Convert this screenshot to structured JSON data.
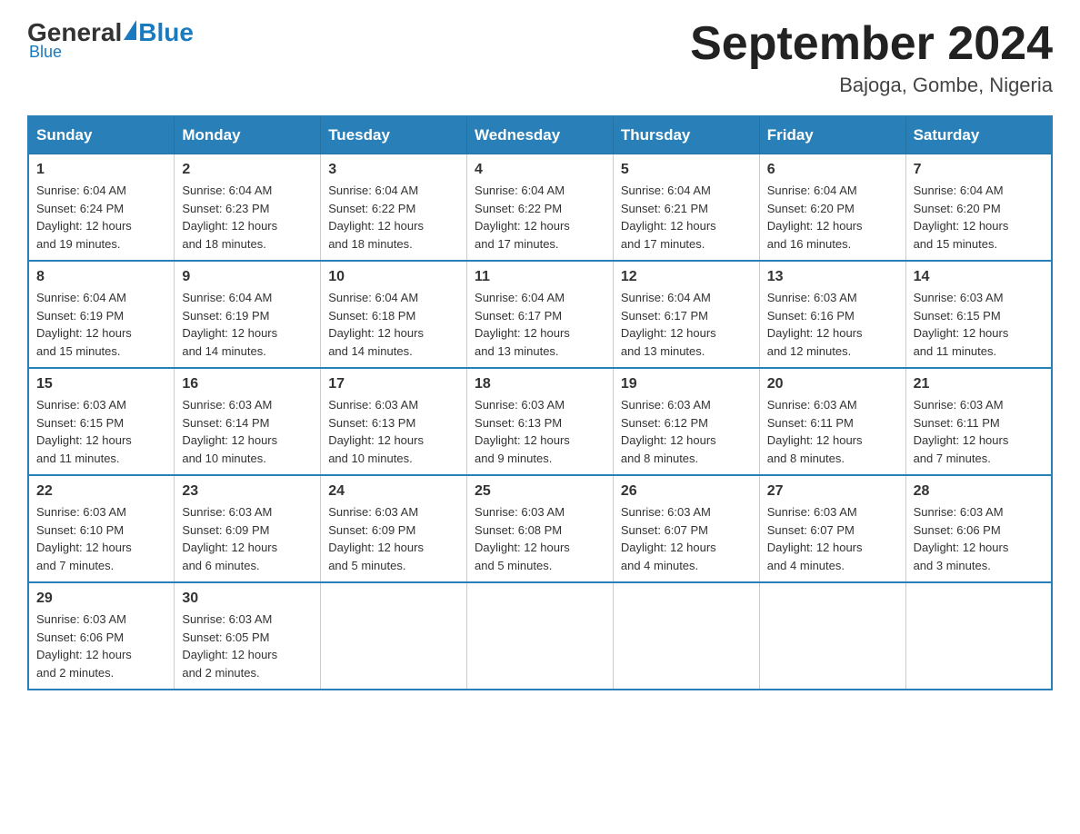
{
  "logo": {
    "general": "General",
    "blue": "Blue"
  },
  "title": {
    "month_year": "September 2024",
    "location": "Bajoga, Gombe, Nigeria"
  },
  "days_of_week": [
    "Sunday",
    "Monday",
    "Tuesday",
    "Wednesday",
    "Thursday",
    "Friday",
    "Saturday"
  ],
  "weeks": [
    [
      {
        "day": "1",
        "sunrise": "6:04 AM",
        "sunset": "6:24 PM",
        "daylight": "12 hours and 19 minutes."
      },
      {
        "day": "2",
        "sunrise": "6:04 AM",
        "sunset": "6:23 PM",
        "daylight": "12 hours and 18 minutes."
      },
      {
        "day": "3",
        "sunrise": "6:04 AM",
        "sunset": "6:22 PM",
        "daylight": "12 hours and 18 minutes."
      },
      {
        "day": "4",
        "sunrise": "6:04 AM",
        "sunset": "6:22 PM",
        "daylight": "12 hours and 17 minutes."
      },
      {
        "day": "5",
        "sunrise": "6:04 AM",
        "sunset": "6:21 PM",
        "daylight": "12 hours and 17 minutes."
      },
      {
        "day": "6",
        "sunrise": "6:04 AM",
        "sunset": "6:20 PM",
        "daylight": "12 hours and 16 minutes."
      },
      {
        "day": "7",
        "sunrise": "6:04 AM",
        "sunset": "6:20 PM",
        "daylight": "12 hours and 15 minutes."
      }
    ],
    [
      {
        "day": "8",
        "sunrise": "6:04 AM",
        "sunset": "6:19 PM",
        "daylight": "12 hours and 15 minutes."
      },
      {
        "day": "9",
        "sunrise": "6:04 AM",
        "sunset": "6:19 PM",
        "daylight": "12 hours and 14 minutes."
      },
      {
        "day": "10",
        "sunrise": "6:04 AM",
        "sunset": "6:18 PM",
        "daylight": "12 hours and 14 minutes."
      },
      {
        "day": "11",
        "sunrise": "6:04 AM",
        "sunset": "6:17 PM",
        "daylight": "12 hours and 13 minutes."
      },
      {
        "day": "12",
        "sunrise": "6:04 AM",
        "sunset": "6:17 PM",
        "daylight": "12 hours and 13 minutes."
      },
      {
        "day": "13",
        "sunrise": "6:03 AM",
        "sunset": "6:16 PM",
        "daylight": "12 hours and 12 minutes."
      },
      {
        "day": "14",
        "sunrise": "6:03 AM",
        "sunset": "6:15 PM",
        "daylight": "12 hours and 11 minutes."
      }
    ],
    [
      {
        "day": "15",
        "sunrise": "6:03 AM",
        "sunset": "6:15 PM",
        "daylight": "12 hours and 11 minutes."
      },
      {
        "day": "16",
        "sunrise": "6:03 AM",
        "sunset": "6:14 PM",
        "daylight": "12 hours and 10 minutes."
      },
      {
        "day": "17",
        "sunrise": "6:03 AM",
        "sunset": "6:13 PM",
        "daylight": "12 hours and 10 minutes."
      },
      {
        "day": "18",
        "sunrise": "6:03 AM",
        "sunset": "6:13 PM",
        "daylight": "12 hours and 9 minutes."
      },
      {
        "day": "19",
        "sunrise": "6:03 AM",
        "sunset": "6:12 PM",
        "daylight": "12 hours and 8 minutes."
      },
      {
        "day": "20",
        "sunrise": "6:03 AM",
        "sunset": "6:11 PM",
        "daylight": "12 hours and 8 minutes."
      },
      {
        "day": "21",
        "sunrise": "6:03 AM",
        "sunset": "6:11 PM",
        "daylight": "12 hours and 7 minutes."
      }
    ],
    [
      {
        "day": "22",
        "sunrise": "6:03 AM",
        "sunset": "6:10 PM",
        "daylight": "12 hours and 7 minutes."
      },
      {
        "day": "23",
        "sunrise": "6:03 AM",
        "sunset": "6:09 PM",
        "daylight": "12 hours and 6 minutes."
      },
      {
        "day": "24",
        "sunrise": "6:03 AM",
        "sunset": "6:09 PM",
        "daylight": "12 hours and 5 minutes."
      },
      {
        "day": "25",
        "sunrise": "6:03 AM",
        "sunset": "6:08 PM",
        "daylight": "12 hours and 5 minutes."
      },
      {
        "day": "26",
        "sunrise": "6:03 AM",
        "sunset": "6:07 PM",
        "daylight": "12 hours and 4 minutes."
      },
      {
        "day": "27",
        "sunrise": "6:03 AM",
        "sunset": "6:07 PM",
        "daylight": "12 hours and 4 minutes."
      },
      {
        "day": "28",
        "sunrise": "6:03 AM",
        "sunset": "6:06 PM",
        "daylight": "12 hours and 3 minutes."
      }
    ],
    [
      {
        "day": "29",
        "sunrise": "6:03 AM",
        "sunset": "6:06 PM",
        "daylight": "12 hours and 2 minutes."
      },
      {
        "day": "30",
        "sunrise": "6:03 AM",
        "sunset": "6:05 PM",
        "daylight": "12 hours and 2 minutes."
      },
      null,
      null,
      null,
      null,
      null
    ]
  ],
  "labels": {
    "sunrise": "Sunrise:",
    "sunset": "Sunset:",
    "daylight": "Daylight:"
  }
}
